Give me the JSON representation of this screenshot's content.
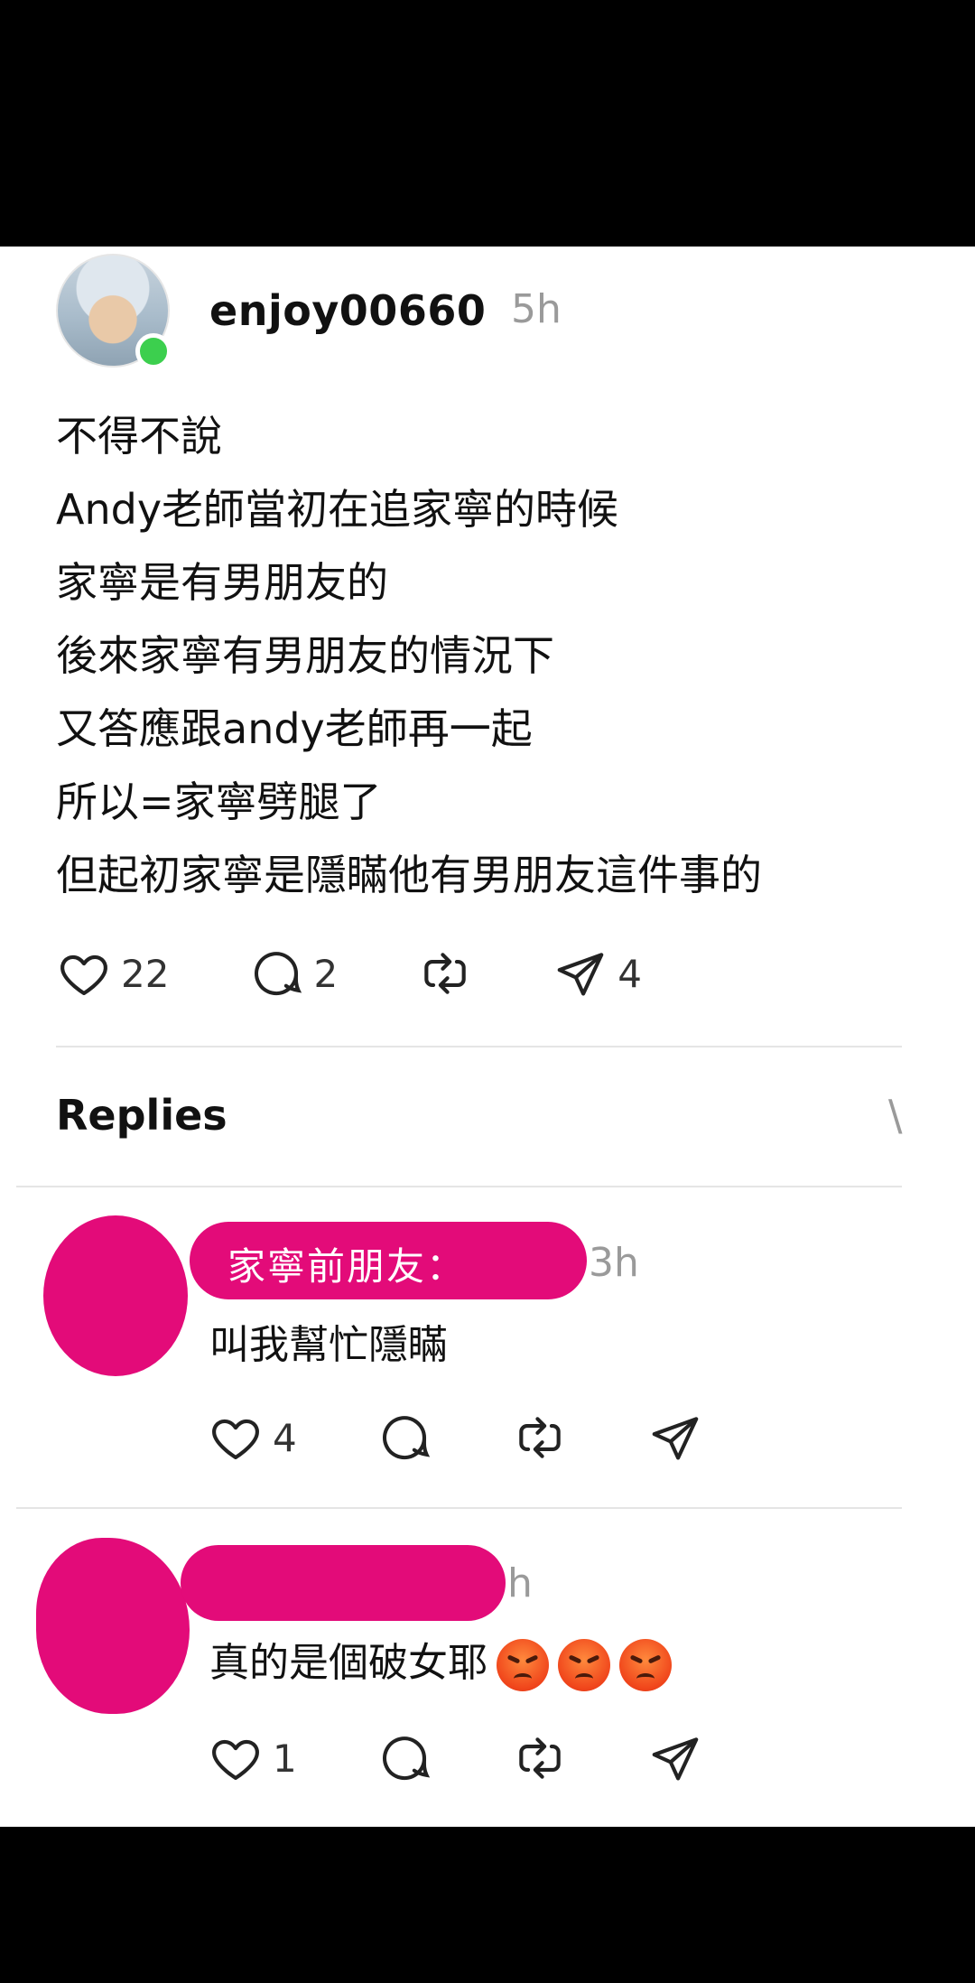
{
  "post": {
    "username": "enjoy00660",
    "time": "5h",
    "lines": [
      "不得不說",
      "Andy老師當初在追家寧的時候",
      "家寧是有男朋友的",
      "後來家寧有男朋友的情況下",
      "又答應跟andy老師再一起",
      "所以=家寧劈腿了",
      "但起初家寧是隱瞞他有男朋友這件事的"
    ],
    "likes": "22",
    "comments": "2",
    "shares": "4"
  },
  "replies_title": "Replies",
  "replies_chevron": "\\",
  "replies": [
    {
      "label": "家寧前朋友：",
      "time": "3h",
      "text": "叫我幫忙隱瞞",
      "likes": "4"
    },
    {
      "time": "h",
      "text": "真的是個破女耶",
      "emoji": [
        "pouting-face",
        "pouting-face",
        "pouting-face"
      ],
      "likes": "1"
    }
  ],
  "colors": {
    "redaction": "#e30b79",
    "online": "#3ccf4e",
    "muted": "#9a9a9a"
  }
}
